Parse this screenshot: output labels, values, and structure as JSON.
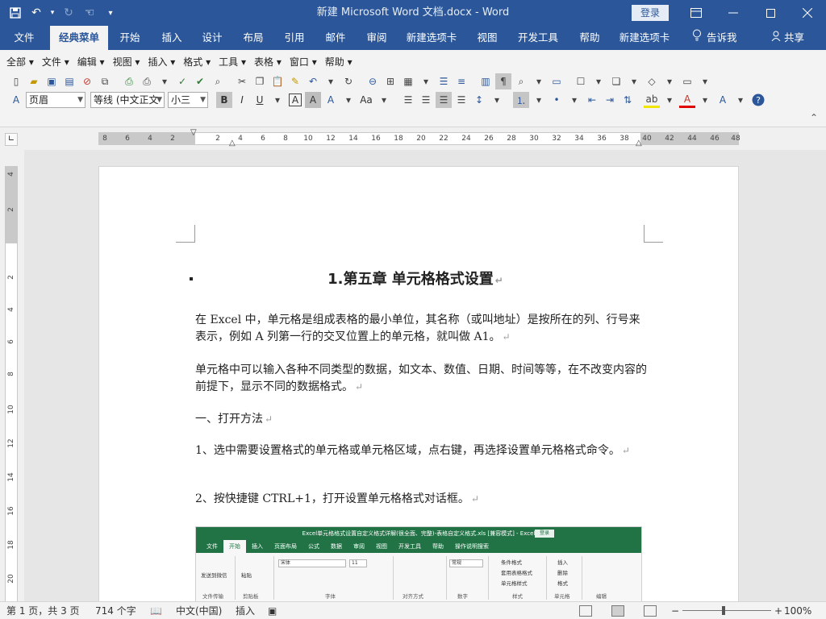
{
  "window": {
    "title": "新建 Microsoft Word 文档.docx  -  Word",
    "login": "登录",
    "colors": {
      "brand": "#2b579a",
      "excel_brand": "#217346"
    }
  },
  "qat": {
    "icons": [
      "save-icon",
      "undo-icon",
      "redo-icon",
      "touch-mode-icon",
      "customize-icon"
    ]
  },
  "tabs": [
    "文件",
    "经典菜单",
    "开始",
    "插入",
    "设计",
    "布局",
    "引用",
    "邮件",
    "审阅",
    "新建选项卡",
    "视图",
    "开发工具",
    "帮助",
    "新建选项卡"
  ],
  "active_tab": "经典菜单",
  "tell_me": "告诉我",
  "share": "共享",
  "classic_menu": [
    "全部",
    "文件",
    "编辑",
    "视图",
    "插入",
    "格式",
    "工具",
    "表格",
    "窗口",
    "帮助"
  ],
  "format_bar": {
    "style": "页眉",
    "font": "等线 (中文正文",
    "size": "小三",
    "bold": "B",
    "italic": "I",
    "underline": "U",
    "char_border": "A",
    "char_shading": "A",
    "font_size_case": "Aa"
  },
  "ruler": {
    "h_numbers": [
      "8",
      "6",
      "4",
      "2",
      "2",
      "4",
      "6",
      "8",
      "10",
      "12",
      "14",
      "16",
      "18",
      "20",
      "22",
      "24",
      "26",
      "28",
      "30",
      "32",
      "34",
      "36",
      "38",
      "40",
      "42",
      "44",
      "46",
      "48"
    ],
    "v_numbers": [
      "4",
      "2",
      "2",
      "4",
      "6",
      "8",
      "10",
      "12",
      "14",
      "16",
      "18",
      "20"
    ]
  },
  "document": {
    "title": "1.第五章  单元格格式设置",
    "paragraphs": [
      "在 Excel 中，单元格是组成表格的最小单位，其名称（或叫地址）是按所在的列、行号来表示，例如 A 列第一行的交叉位置上的单元格，就叫做 A1。",
      "单元格中可以输入各种不同类型的数据，如文本、数值、日期、时间等等，在不改变内容的前提下，显示不同的数据格式。",
      "一、打开方法",
      "1、选中需要设置格式的单元格或单元格区域，点右键，再选择设置单元格格式命令。",
      "2、按快捷键 CTRL+1，打开设置单元格格式对话框。"
    ],
    "return_mark": "↵"
  },
  "embedded_excel": {
    "title": "Excel单元格格式设置自定义格式详解(很全面、完整)-表格自定义格式.xls  [兼容模式]  -  Excel",
    "login": "登录",
    "tabs": [
      "文件",
      "开始",
      "插入",
      "页面布局",
      "公式",
      "数据",
      "审阅",
      "视图",
      "开发工具",
      "帮助",
      "操作说明搜索"
    ],
    "active_tab": "开始",
    "items": {
      "send_to_wechat": "发送到微信",
      "paste": "粘贴",
      "font_name": "宋体",
      "font_size": "11",
      "number_format": "常规",
      "conditional": "条件格式",
      "table_format": "套用表格格式",
      "cell_style": "单元格样式",
      "insert": "插入",
      "delete": "删除",
      "format": "格式"
    },
    "groups": [
      "文件传输",
      "剪贴板",
      "字体",
      "对齐方式",
      "数字",
      "样式",
      "单元格",
      "编辑"
    ]
  },
  "status": {
    "page": "第 1 页，共 3 页",
    "words": "714 个字",
    "language": "中文(中国)",
    "mode": "插入",
    "zoom_minus": "−",
    "zoom_plus": "+",
    "zoom": "100%"
  }
}
